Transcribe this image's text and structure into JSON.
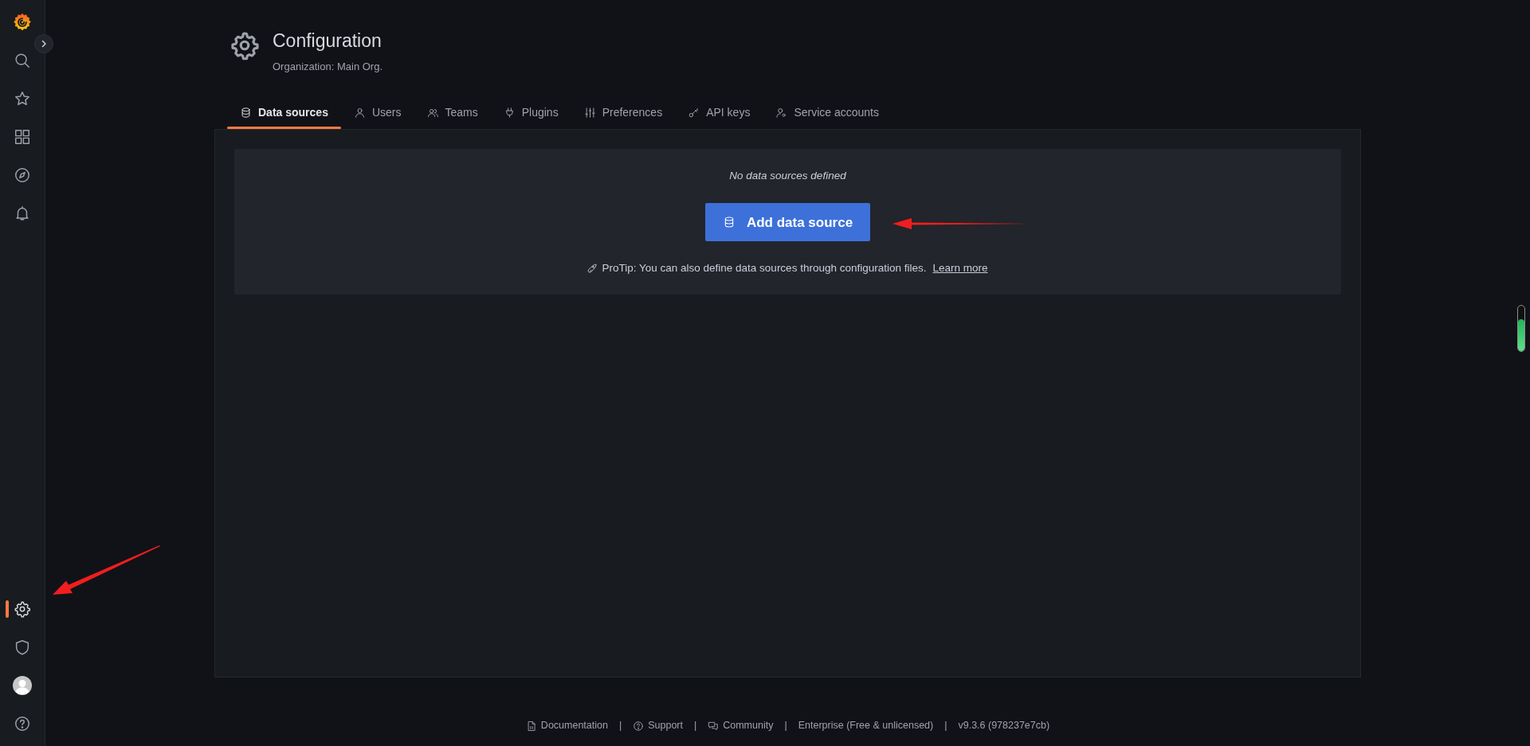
{
  "sidebar": {
    "top_items": [
      {
        "kind": "search",
        "selected": false
      },
      {
        "kind": "star",
        "selected": false
      },
      {
        "kind": "grid",
        "selected": false
      },
      {
        "kind": "compass",
        "selected": false
      },
      {
        "kind": "bell",
        "selected": false
      }
    ],
    "bottom_items": [
      {
        "kind": "gear",
        "selected": true
      },
      {
        "kind": "shield",
        "selected": false
      },
      {
        "kind": "avatar",
        "selected": false
      },
      {
        "kind": "help",
        "selected": false
      }
    ]
  },
  "header": {
    "title": "Configuration",
    "subtitle": "Organization: Main Org."
  },
  "tabs": [
    {
      "kind": "database",
      "label": "Data sources",
      "selected": true
    },
    {
      "kind": "user",
      "label": "Users",
      "selected": false
    },
    {
      "kind": "users",
      "label": "Teams",
      "selected": false
    },
    {
      "kind": "plug",
      "label": "Plugins",
      "selected": false
    },
    {
      "kind": "sliders",
      "label": "Preferences",
      "selected": false
    },
    {
      "kind": "key",
      "label": "API keys",
      "selected": false
    },
    {
      "kind": "user-cog",
      "label": "Service accounts",
      "selected": false
    }
  ],
  "empty_state": {
    "message": "No data sources defined",
    "button": "Add data source",
    "protip": "ProTip: You can also define data sources through configuration files.",
    "link": "Learn more"
  },
  "footer": [
    {
      "kind": "doc",
      "label": "Documentation"
    },
    {
      "kind": "help",
      "label": "Support",
      "separator": "|"
    },
    {
      "kind": "chat",
      "label": "Community",
      "separator": "|"
    },
    {
      "kind": "none",
      "label": "Enterprise (Free & unlicensed)",
      "separator": "|"
    },
    {
      "kind": "none",
      "label": "v9.3.6 (978237e7cb)",
      "separator": "|"
    }
  ],
  "side_meter": {
    "level": 0.7
  }
}
